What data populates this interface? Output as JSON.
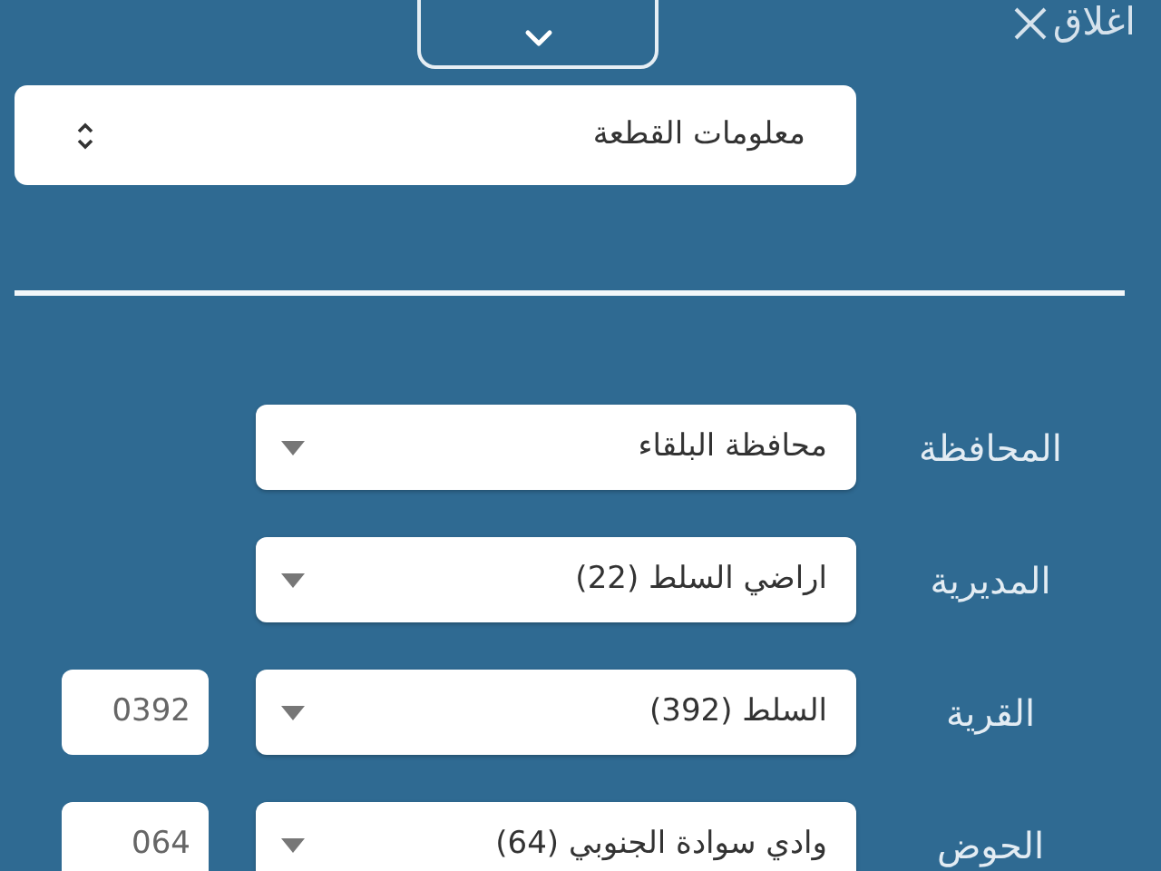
{
  "close": {
    "label": "اغلاق"
  },
  "section_select": {
    "value": "معلومات القطعة"
  },
  "fields": [
    {
      "label": "المحافظة",
      "value": "محافظة البلقاء"
    },
    {
      "label": "المديرية",
      "value": "اراضي السلط (22)"
    },
    {
      "label": "القرية",
      "value": "السلط (392)",
      "code": "0392"
    },
    {
      "label": "الحوض",
      "value": "وادي سوادة الجنوبي (64)",
      "code": "064"
    }
  ]
}
